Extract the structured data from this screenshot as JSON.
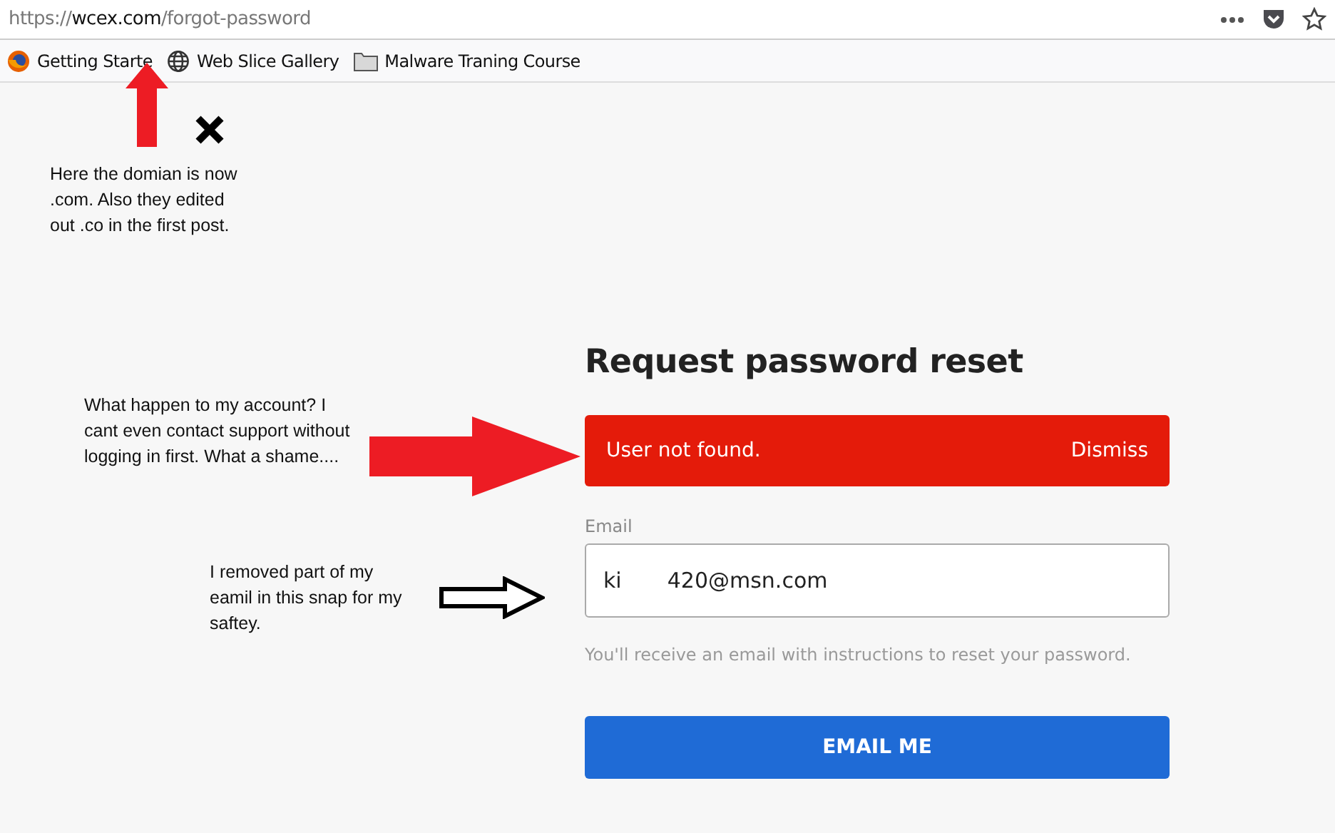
{
  "address_bar": {
    "url_scheme": "https://",
    "url_host": "wcex.com",
    "url_path": "/forgot-password"
  },
  "bookmarks": [
    {
      "kind": "firefox",
      "label": "Getting Starte"
    },
    {
      "kind": "globe",
      "label": "Web Slice Gallery"
    },
    {
      "kind": "folder",
      "label": "Malware Traning Course"
    }
  ],
  "form": {
    "title": "Request password reset",
    "alert": {
      "message": "User not found.",
      "action": "Dismiss"
    },
    "email": {
      "label": "Email",
      "value_parts": [
        "ki",
        "420@msn.com"
      ]
    },
    "hint": "You'll receive an email with instructions to reset your password.",
    "button": "EMAIL ME"
  },
  "notes": [
    "Here the domian is now .com. Also they edited out .co in the first post.",
    "What happen to my account? I cant even contact support without logging in first. What a shame....",
    "I removed part of my eamil in this snap for my saftey."
  ]
}
